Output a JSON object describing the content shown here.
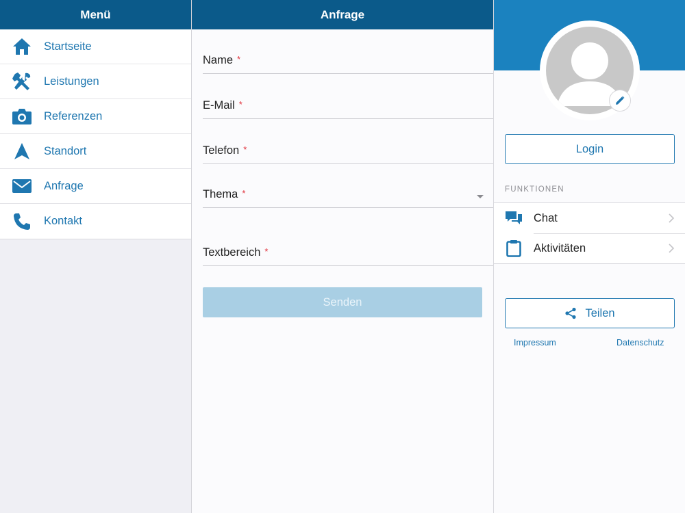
{
  "menu": {
    "title": "Menü",
    "items": [
      {
        "label": "Startseite",
        "icon": "home-icon"
      },
      {
        "label": "Leistungen",
        "icon": "tools-icon"
      },
      {
        "label": "Referenzen",
        "icon": "camera-icon"
      },
      {
        "label": "Standort",
        "icon": "navigation-arrow-icon"
      },
      {
        "label": "Anfrage",
        "icon": "mail-icon"
      },
      {
        "label": "Kontakt",
        "icon": "phone-icon"
      }
    ]
  },
  "form": {
    "title": "Anfrage",
    "required_marker": "*",
    "fields": [
      {
        "label": "Name"
      },
      {
        "label": "E-Mail"
      },
      {
        "label": "Telefon"
      },
      {
        "label": "Thema"
      },
      {
        "label": "Textbereich"
      }
    ],
    "submit_label": "Senden"
  },
  "profile": {
    "login_label": "Login",
    "functions_title": "FUNKTIONEN",
    "functions": [
      {
        "label": "Chat",
        "icon": "chat-bubbles-icon"
      },
      {
        "label": "Aktivitäten",
        "icon": "clipboard-icon"
      }
    ],
    "share_label": "Teilen",
    "impressum_label": "Impressum",
    "datenschutz_label": "Datenschutz"
  },
  "colors": {
    "header_bg": "#0b5a8a",
    "accent": "#1f77b0",
    "profile_banner": "#1b82bf",
    "submit_disabled": "#a9cfe4",
    "required": "#e0303a"
  }
}
